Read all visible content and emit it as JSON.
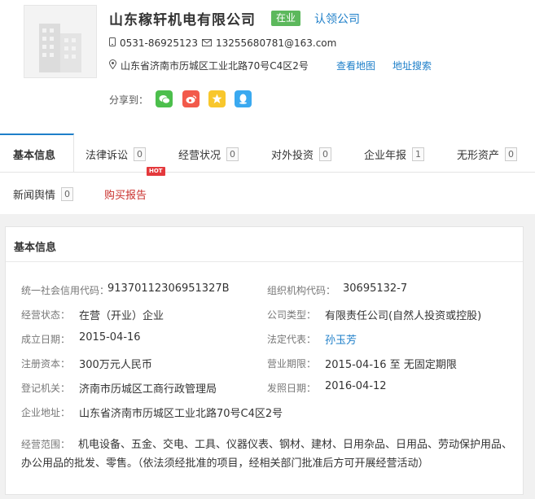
{
  "company": {
    "name": "山东稼轩机电有限公司",
    "status": "在业",
    "claim_label": "认领公司",
    "phone": "0531-86925123",
    "email": "13255680781@163.com",
    "address": "山东省济南市历城区工业北路70号C4区2号",
    "map_label": "查看地图",
    "address_search_label": "地址搜索",
    "share_label": "分享到："
  },
  "icons": {
    "phone": "phone-icon",
    "email": "mail-icon",
    "address": "location-pin-icon",
    "share": [
      "wechat-icon",
      "weibo-icon",
      "favorite-star-icon",
      "qq-icon"
    ]
  },
  "colors": {
    "accent": "#1e7fc9",
    "status_green": "#5cb85c",
    "hot_red": "#e4393c"
  },
  "tabs": [
    {
      "label": "基本信息",
      "count": null,
      "active": true
    },
    {
      "label": "法律诉讼",
      "count": "0"
    },
    {
      "label": "经营状况",
      "count": "0"
    },
    {
      "label": "对外投资",
      "count": "0"
    },
    {
      "label": "企业年报",
      "count": "1"
    },
    {
      "label": "无形资产",
      "count": "0"
    },
    {
      "label": "新闻舆情",
      "count": "0"
    },
    {
      "label": "购买报告",
      "count": null,
      "badge": "HOT"
    }
  ],
  "panel": {
    "title": "基本信息",
    "fields": {
      "credit_code_label": "统一社会信用代码：",
      "credit_code": "91370112306951327B",
      "org_code_label": "组织机构代码：",
      "org_code": "30695132-7",
      "status_label": "经营状态：",
      "status": "在营（开业）企业",
      "type_label": "公司类型：",
      "type": "有限责任公司(自然人投资或控股)",
      "founded_label": "成立日期：",
      "founded": "2015-04-16",
      "legal_rep_label": "法定代表：",
      "legal_rep": "孙玉芳",
      "capital_label": "注册资本：",
      "capital": "300万元人民币",
      "term_label": "营业期限：",
      "term": "2015-04-16 至 无固定期限",
      "authority_label": "登记机关：",
      "authority": "济南市历城区工商行政管理局",
      "issue_date_label": "发照日期：",
      "issue_date": "2016-04-12",
      "address_label": "企业地址：",
      "address": "山东省济南市历城区工业北路70号C4区2号",
      "scope_label": "经营范围：",
      "scope": "机电设备、五金、交电、工具、仪器仪表、钢材、建材、日用杂品、日用品、劳动保护用品、办公用品的批发、零售。（依法须经批准的项目，经相关部门批准后方可开展经营活动）"
    }
  }
}
